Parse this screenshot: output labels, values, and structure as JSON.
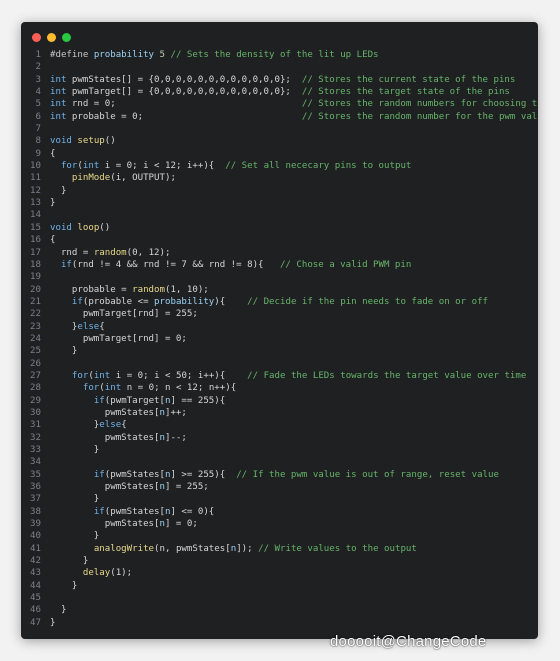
{
  "window": {
    "buttons": [
      {
        "name": "close",
        "color": "#ff5f57"
      },
      {
        "name": "minimize",
        "color": "#febc2e"
      },
      {
        "name": "maximize",
        "color": "#28c840"
      }
    ]
  },
  "code_lines": [
    {
      "n": "1",
      "tokens": [
        [
          "pp",
          "#define "
        ],
        [
          "id",
          "probability"
        ],
        [
          "t",
          " "
        ],
        [
          "num",
          "5"
        ],
        [
          "cm",
          " // Sets the density of the lit up LEDs"
        ]
      ]
    },
    {
      "n": "2",
      "tokens": []
    },
    {
      "n": "3",
      "tokens": [
        [
          "kw",
          "int"
        ],
        [
          "t",
          " pwmStates[] = {0,0,0,0,0,0,0,0,0,0,0,0};  "
        ],
        [
          "cm",
          "// Stores the current state of the pins"
        ]
      ]
    },
    {
      "n": "4",
      "tokens": [
        [
          "kw",
          "int"
        ],
        [
          "t",
          " pwmTarget[] = {0,0,0,0,0,0,0,0,0,0,0,0};  "
        ],
        [
          "cm",
          "// Stores the target state of the pins"
        ]
      ]
    },
    {
      "n": "5",
      "tokens": [
        [
          "kw",
          "int"
        ],
        [
          "t",
          " rnd = 0;                                  "
        ],
        [
          "cm",
          "// Stores the random numbers for choosing the pins"
        ]
      ]
    },
    {
      "n": "6",
      "tokens": [
        [
          "kw",
          "int"
        ],
        [
          "t",
          " probable = 0;                             "
        ],
        [
          "cm",
          "// Stores the random number for the pwm values"
        ]
      ]
    },
    {
      "n": "7",
      "tokens": []
    },
    {
      "n": "8",
      "tokens": [
        [
          "kw",
          "void"
        ],
        [
          "t",
          " "
        ],
        [
          "fn",
          "setup"
        ],
        [
          "t",
          "()"
        ]
      ]
    },
    {
      "n": "9",
      "tokens": [
        [
          "t",
          "{"
        ]
      ]
    },
    {
      "n": "10",
      "tokens": [
        [
          "t",
          "  "
        ],
        [
          "kw",
          "for"
        ],
        [
          "t",
          "("
        ],
        [
          "kw",
          "int"
        ],
        [
          "t",
          " i = 0; i < 12; i++){  "
        ],
        [
          "cm",
          "// Set all nececary pins to output"
        ]
      ]
    },
    {
      "n": "11",
      "tokens": [
        [
          "t",
          "    "
        ],
        [
          "fn",
          "pinMode"
        ],
        [
          "t",
          "(i, OUTPUT);"
        ]
      ]
    },
    {
      "n": "12",
      "tokens": [
        [
          "t",
          "  }"
        ]
      ]
    },
    {
      "n": "13",
      "tokens": [
        [
          "t",
          "}"
        ]
      ]
    },
    {
      "n": "14",
      "tokens": []
    },
    {
      "n": "15",
      "tokens": [
        [
          "kw",
          "void"
        ],
        [
          "t",
          " "
        ],
        [
          "fn",
          "loop"
        ],
        [
          "t",
          "()"
        ]
      ]
    },
    {
      "n": "16",
      "tokens": [
        [
          "t",
          "{"
        ]
      ]
    },
    {
      "n": "17",
      "tokens": [
        [
          "t",
          "  rnd = "
        ],
        [
          "fn",
          "random"
        ],
        [
          "t",
          "(0, 12);"
        ]
      ]
    },
    {
      "n": "18",
      "tokens": [
        [
          "t",
          "  "
        ],
        [
          "kw",
          "if"
        ],
        [
          "t",
          "(rnd != 4 && rnd != 7 && rnd != 8){   "
        ],
        [
          "cm",
          "// Chose a valid PWM pin"
        ]
      ]
    },
    {
      "n": "19",
      "tokens": []
    },
    {
      "n": "20",
      "tokens": [
        [
          "t",
          "    probable = "
        ],
        [
          "fn",
          "random"
        ],
        [
          "t",
          "(1, 10);"
        ]
      ]
    },
    {
      "n": "21",
      "tokens": [
        [
          "t",
          "    "
        ],
        [
          "kw",
          "if"
        ],
        [
          "t",
          "(probable <= "
        ],
        [
          "id",
          "probability"
        ],
        [
          "t",
          "){    "
        ],
        [
          "cm",
          "// Decide if the pin needs to fade on or off"
        ]
      ]
    },
    {
      "n": "22",
      "tokens": [
        [
          "t",
          "      pwmTarget[rnd] = 255;"
        ]
      ]
    },
    {
      "n": "23",
      "tokens": [
        [
          "t",
          "    }"
        ],
        [
          "kw",
          "else"
        ],
        [
          "t",
          "{"
        ]
      ]
    },
    {
      "n": "24",
      "tokens": [
        [
          "t",
          "      pwmTarget[rnd] = 0;"
        ]
      ]
    },
    {
      "n": "25",
      "tokens": [
        [
          "t",
          "    }"
        ]
      ]
    },
    {
      "n": "26",
      "tokens": []
    },
    {
      "n": "27",
      "tokens": [
        [
          "t",
          "    "
        ],
        [
          "kw",
          "for"
        ],
        [
          "t",
          "("
        ],
        [
          "kw",
          "int"
        ],
        [
          "t",
          " i = 0; i < 50; i++){    "
        ],
        [
          "cm",
          "// Fade the LEDs towards the target value over time"
        ]
      ]
    },
    {
      "n": "28",
      "tokens": [
        [
          "t",
          "      "
        ],
        [
          "kw",
          "for"
        ],
        [
          "t",
          "("
        ],
        [
          "kw",
          "int"
        ],
        [
          "t",
          " n = 0; n < 12; n++){"
        ]
      ]
    },
    {
      "n": "29",
      "tokens": [
        [
          "t",
          "        "
        ],
        [
          "kw",
          "if"
        ],
        [
          "t",
          "(pwmTarget["
        ],
        [
          "id",
          "n"
        ],
        [
          "t",
          "] == 255){"
        ]
      ]
    },
    {
      "n": "30",
      "tokens": [
        [
          "t",
          "          pwmStates["
        ],
        [
          "id",
          "n"
        ],
        [
          "t",
          "]++;"
        ]
      ]
    },
    {
      "n": "31",
      "tokens": [
        [
          "t",
          "        }"
        ],
        [
          "kw",
          "else"
        ],
        [
          "t",
          "{"
        ]
      ]
    },
    {
      "n": "32",
      "tokens": [
        [
          "t",
          "          pwmStates["
        ],
        [
          "id",
          "n"
        ],
        [
          "t",
          "]--;"
        ]
      ]
    },
    {
      "n": "33",
      "tokens": [
        [
          "t",
          "        }"
        ]
      ]
    },
    {
      "n": "34",
      "tokens": []
    },
    {
      "n": "35",
      "tokens": [
        [
          "t",
          "        "
        ],
        [
          "kw",
          "if"
        ],
        [
          "t",
          "(pwmStates["
        ],
        [
          "id",
          "n"
        ],
        [
          "t",
          "] >= 255){  "
        ],
        [
          "cm",
          "// If the pwm value is out of range, reset value"
        ]
      ]
    },
    {
      "n": "36",
      "tokens": [
        [
          "t",
          "          pwmStates["
        ],
        [
          "id",
          "n"
        ],
        [
          "t",
          "] = 255;"
        ]
      ]
    },
    {
      "n": "37",
      "tokens": [
        [
          "t",
          "        }"
        ]
      ]
    },
    {
      "n": "38",
      "tokens": [
        [
          "t",
          "        "
        ],
        [
          "kw",
          "if"
        ],
        [
          "t",
          "(pwmStates["
        ],
        [
          "id",
          "n"
        ],
        [
          "t",
          "] <= 0){"
        ]
      ]
    },
    {
      "n": "39",
      "tokens": [
        [
          "t",
          "          pwmStates["
        ],
        [
          "id",
          "n"
        ],
        [
          "t",
          "] = 0;"
        ]
      ]
    },
    {
      "n": "40",
      "tokens": [
        [
          "t",
          "        }"
        ]
      ]
    },
    {
      "n": "41",
      "tokens": [
        [
          "t",
          "        "
        ],
        [
          "fn",
          "analogWrite"
        ],
        [
          "t",
          "(n, pwmStates["
        ],
        [
          "id",
          "n"
        ],
        [
          "t",
          "]); "
        ],
        [
          "cm",
          "// Write values to the output"
        ]
      ]
    },
    {
      "n": "42",
      "tokens": [
        [
          "t",
          "      }"
        ]
      ]
    },
    {
      "n": "43",
      "tokens": [
        [
          "t",
          "      "
        ],
        [
          "fn",
          "delay"
        ],
        [
          "t",
          "(1);"
        ]
      ]
    },
    {
      "n": "44",
      "tokens": [
        [
          "t",
          "    }"
        ]
      ]
    },
    {
      "n": "45",
      "tokens": []
    },
    {
      "n": "46",
      "tokens": [
        [
          "t",
          "  }"
        ]
      ]
    },
    {
      "n": "47",
      "tokens": [
        [
          "t",
          "}"
        ]
      ]
    }
  ],
  "watermark": "dooooit@ChangeCode"
}
